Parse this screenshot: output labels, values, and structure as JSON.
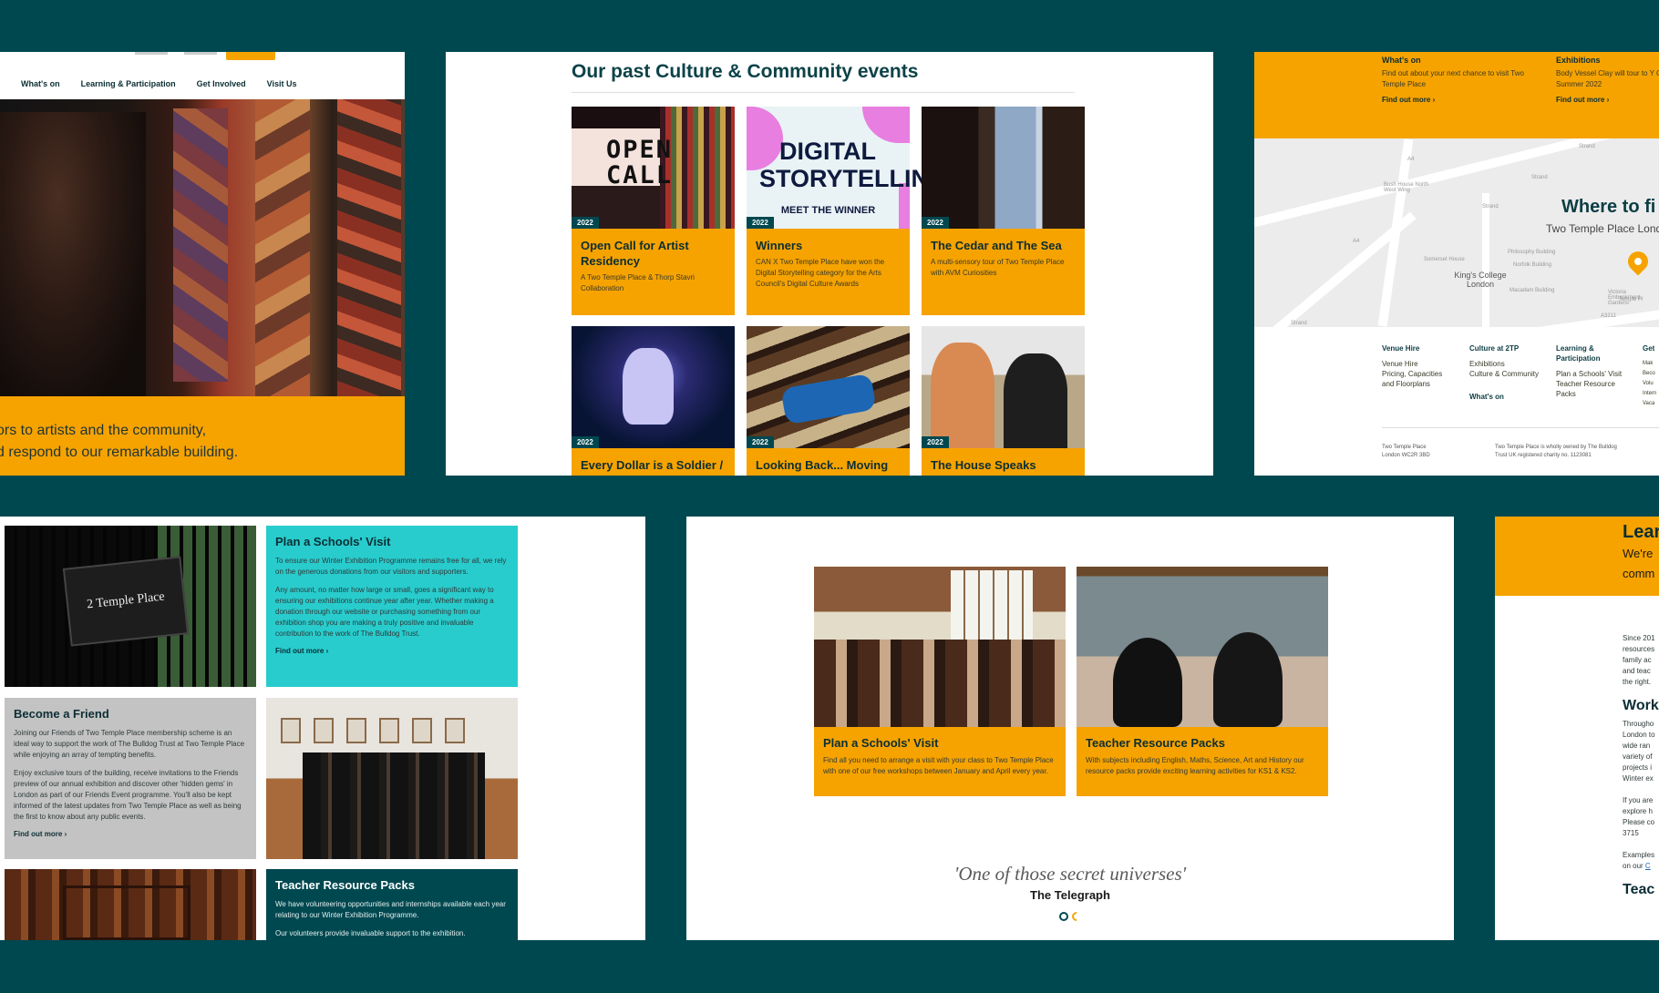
{
  "panel1": {
    "nav": [
      "What's on",
      "Learning & Participation",
      "Get Involved",
      "Visit Us"
    ],
    "quote_line1": "ors to artists and the community,",
    "quote_line2": "d respond to our remarkable building."
  },
  "panel2": {
    "heading": "Our past Culture & Community events",
    "open_call_word": "OPEN CALL",
    "digital_word": "DIGITAL STORYTELLING",
    "digital_sub": "MEET THE WINNER",
    "cards": [
      {
        "tag": "2022",
        "title": "Open Call for Artist Residency",
        "desc": "A Two Temple Place & Thorp Stavri Collaboration"
      },
      {
        "tag": "2022",
        "title": "Winners",
        "desc": "CAN X Two Temple Place have won the Digital Storytelling category for the Arts Council's Digital Culture Awards"
      },
      {
        "tag": "2022",
        "title": "The Cedar and The Sea",
        "desc": "A multi-sensory tour of Two Temple Place with AVM Curiosities"
      },
      {
        "tag": "2022",
        "title": "Every Dollar is a Soldier /",
        "desc": ""
      },
      {
        "tag": "2022",
        "title": "Looking Back... Moving",
        "desc": ""
      },
      {
        "tag": "2022",
        "title": "The House Speaks",
        "desc": ""
      }
    ]
  },
  "panel3": {
    "col1": {
      "title": "What's on",
      "desc": "Find out about your next chance to visit Two Temple Place",
      "link": "Find out more"
    },
    "col2": {
      "title": "Exhibitions",
      "desc": "Body Vessel Clay will tour to Y Gallery in Summer 2022",
      "link": "Find out more"
    },
    "map_heading": "Where to fi",
    "map_sub": "Two Temple Place Lond",
    "map_kings": "King's College London",
    "map_streets": [
      "Strand",
      "Strand",
      "Strand",
      "Strand",
      "A4",
      "A4",
      "A3211",
      "Temple Pl",
      "Somerset House",
      "Bush House North West Wing",
      "Philosophy Building",
      "Norfolk Building",
      "Macadam Building",
      "Victoria Embankment Gardens"
    ],
    "footer": [
      {
        "title": "Venue Hire",
        "items": [
          "Venue Hire",
          "Pricing, Capacities and Floorplans"
        ]
      },
      {
        "title": "Culture at 2TP",
        "items": [
          "Exhibitions",
          "Culture & Community"
        ]
      },
      {
        "title": "Learning & Participation",
        "items": [
          "Plan a Schools' Visit",
          "Teacher Resource Packs"
        ]
      },
      {
        "title": "Get",
        "items": [
          "Mak",
          "Beco",
          "Volu",
          "Intern",
          "Vaca"
        ]
      }
    ],
    "whats_on": "What's on",
    "address1": "Two Temple Place\nLondon WC2R 3BD",
    "address2": "Two Temple Place is wholly owned by The Bulldog Trust UK registered charity no. 1123081"
  },
  "panel4": {
    "sign_text": "2 Temple Place",
    "schools_title": "Plan a Schools' Visit",
    "schools_p1": "To ensure our Winter Exhibition Programme remains free for all, we rely on the generous donations from our visitors and supporters.",
    "schools_p2": "Any amount, no matter how large or small, goes a significant way to ensuring our exhibitions continue year after year. Whether making a donation through our website or purchasing something from our exhibition shop you are making a truly positive and invaluable contribution to the work of The Bulldog Trust.",
    "schools_link": "Find out more",
    "friend_title": "Become a Friend",
    "friend_p1": "Joining our Friends of Two Temple Place membership scheme is an ideal way to support the work of The Bulldog Trust at Two Temple Place while enjoying an array of tempting benefits.",
    "friend_p2": "Enjoy exclusive tours of the building, receive invitations to the Friends preview of our annual exhibition and discover other 'hidden gems' in London as part of our Friends Event programme. You'll also be kept informed of the latest updates from Two Temple Place as well as being the first to know about any public events.",
    "friend_link": "Find out more",
    "teacher_title": "Teacher Resource Packs",
    "teacher_p1": "We have volunteering opportunities and internships available each year relating to our Winter Exhibition Programme.",
    "teacher_p2": "Our volunteers provide invaluable support to the exhibition."
  },
  "panel5": {
    "cards": [
      {
        "title": "Plan a Schools' Visit",
        "desc": "Find all you need to arrange a visit with your class to Two Temple Place with one of our free workshops between January and April every year."
      },
      {
        "title": "Teacher Resource Packs",
        "desc": "With subjects including English, Maths, Science, Art and History our resource packs provide exciting learning activities for KS1 & KS2."
      }
    ],
    "quote": "'One of those secret universes'",
    "source": "The Telegraph"
  },
  "panel6": {
    "title": "Lear",
    "p_line1": "We're",
    "p_line2": "comm",
    "body_lines": [
      "Since 201",
      "resources",
      "family ac",
      "and teac",
      "the right."
    ],
    "h_work": "Work",
    "work_lines": [
      "Througho",
      "London to",
      "wide ran",
      "variety of",
      "projects i",
      "Winter ex"
    ],
    "if_lines": [
      "If you are",
      "explore h",
      "Please co",
      "3715"
    ],
    "ex_lines": [
      "Examples",
      "on our "
    ],
    "link": "C",
    "h_teach": "Teac"
  },
  "colors": {
    "orange": "#f6a300",
    "teal": "#28cccd",
    "dark_teal": "#004850",
    "grey": "#c3c3c3"
  }
}
